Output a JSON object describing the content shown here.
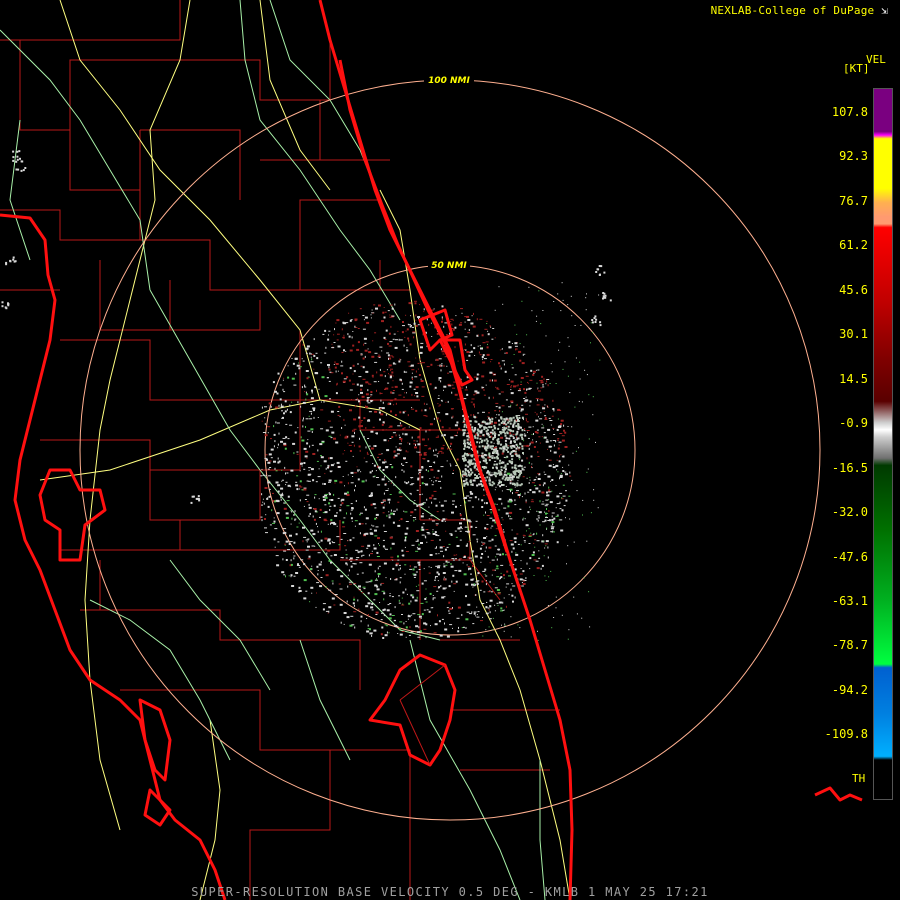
{
  "credit": {
    "text": "NEXLAB-College of DuPage",
    "mark_icon": "corner-arrow-icon"
  },
  "rings": [
    {
      "label": "100 NMI"
    },
    {
      "label": "50 NMI"
    }
  ],
  "legend": {
    "title": "VEL",
    "unit": "[KT]",
    "ticks": [
      "107.8",
      "92.3",
      "76.7",
      "61.2",
      "45.6",
      "30.1",
      "14.5",
      "-0.9",
      "-16.5",
      "-32.0",
      "-47.6",
      "-63.1",
      "-78.7",
      "-94.2",
      "-109.8"
    ],
    "th_label": "TH",
    "colors": {
      "purple": "#7a0080",
      "yellow": "#ffff00",
      "salmon": "#ff9a70",
      "red": "#ff0000",
      "dark_red": "#5a0000",
      "gray": "#cfcfcf",
      "dark_green": "#003a00",
      "green": "#00ff40",
      "blue": "#0060d0",
      "cyan": "#00b0ff",
      "black": "#000000"
    }
  },
  "map_colors": {
    "coast": "#ff1010",
    "county": "#c01818",
    "road_yellow": "#ffff80",
    "road_green": "#b0ffb0",
    "ring": "#ffb090",
    "echo_gray": "#d8d8d8",
    "echo_red": "#a02020",
    "echo_green": "#50c050"
  },
  "footer": {
    "text": "SUPER-RESOLUTION BASE VELOCITY 0.5 DEG - KMLB 1 MAY 25 17:21"
  }
}
